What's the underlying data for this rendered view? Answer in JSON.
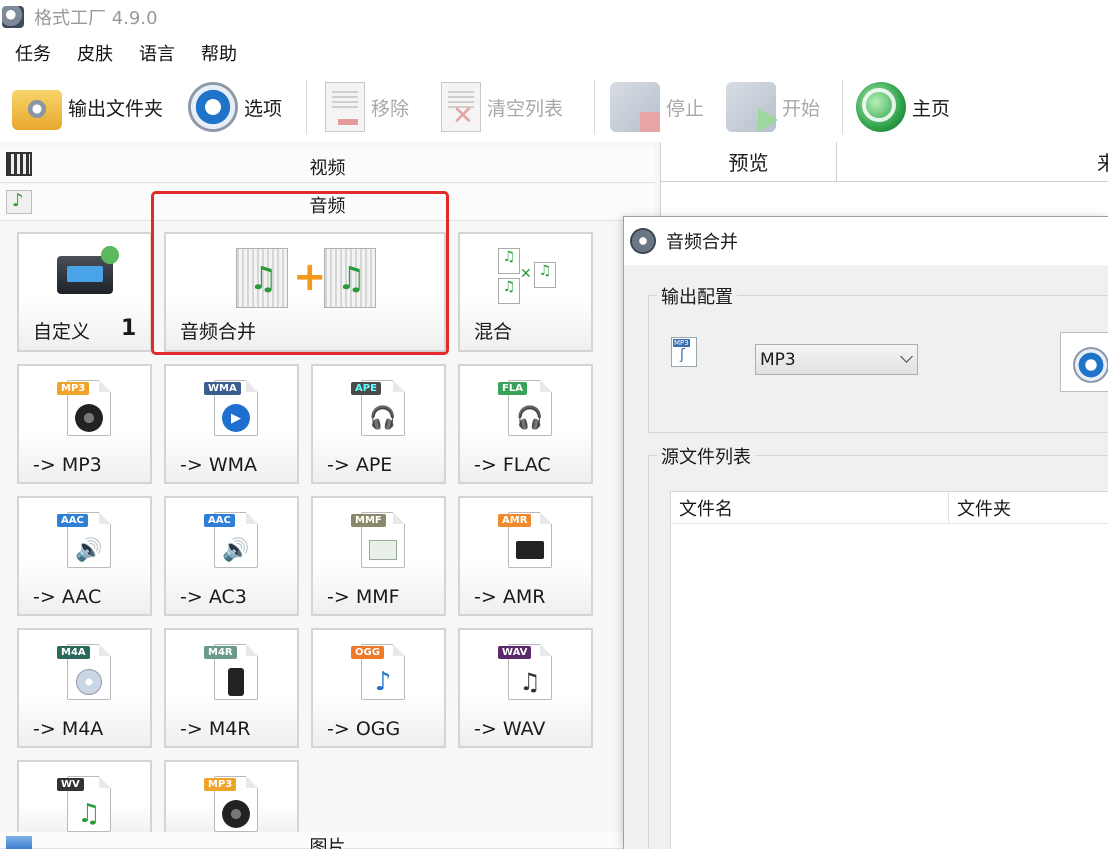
{
  "window": {
    "title": "格式工厂 4.9.0"
  },
  "menu": {
    "items": [
      "任务",
      "皮肤",
      "语言",
      "帮助"
    ]
  },
  "toolbar": {
    "output_folder": "输出文件夹",
    "options": "选项",
    "remove": "移除",
    "clear_list": "清空列表",
    "stop": "停止",
    "start": "开始",
    "home": "主页"
  },
  "categories": {
    "video": "视频",
    "audio": "音频",
    "image": "图片"
  },
  "tiles": {
    "custom": "自定义",
    "merge": "音频合并",
    "mix": "混合",
    "mp3": "-> MP3",
    "wma": "-> WMA",
    "ape": "-> APE",
    "flac": "-> FLAC",
    "aac": "-> AAC",
    "ac3": "-> AC3",
    "mmf": "-> MMF",
    "amr": "-> AMR",
    "m4a": "-> M4A",
    "m4r": "-> M4R",
    "ogg": "-> OGG",
    "wav": "-> WAV"
  },
  "badges": {
    "mp3": "MP3",
    "wma": "WMA",
    "ape": "APE",
    "flac": "FLA",
    "aac": "AAC",
    "ac3": "AAC",
    "mmf": "MMF",
    "amr": "AMR",
    "m4a": "M4A",
    "m4r": "M4R",
    "ogg": "OGG",
    "wav": "WAV",
    "wv": "WV",
    "mp3b": "MP3"
  },
  "annotation": {
    "number": "1"
  },
  "main_grid": {
    "preview": "预览",
    "source": "来源"
  },
  "dialog": {
    "title": "音频合并",
    "output_config_label": "输出配置",
    "format_value": "MP3",
    "source_list_label": "源文件列表",
    "columns": {
      "filename": "文件名",
      "folder": "文件夹"
    }
  }
}
